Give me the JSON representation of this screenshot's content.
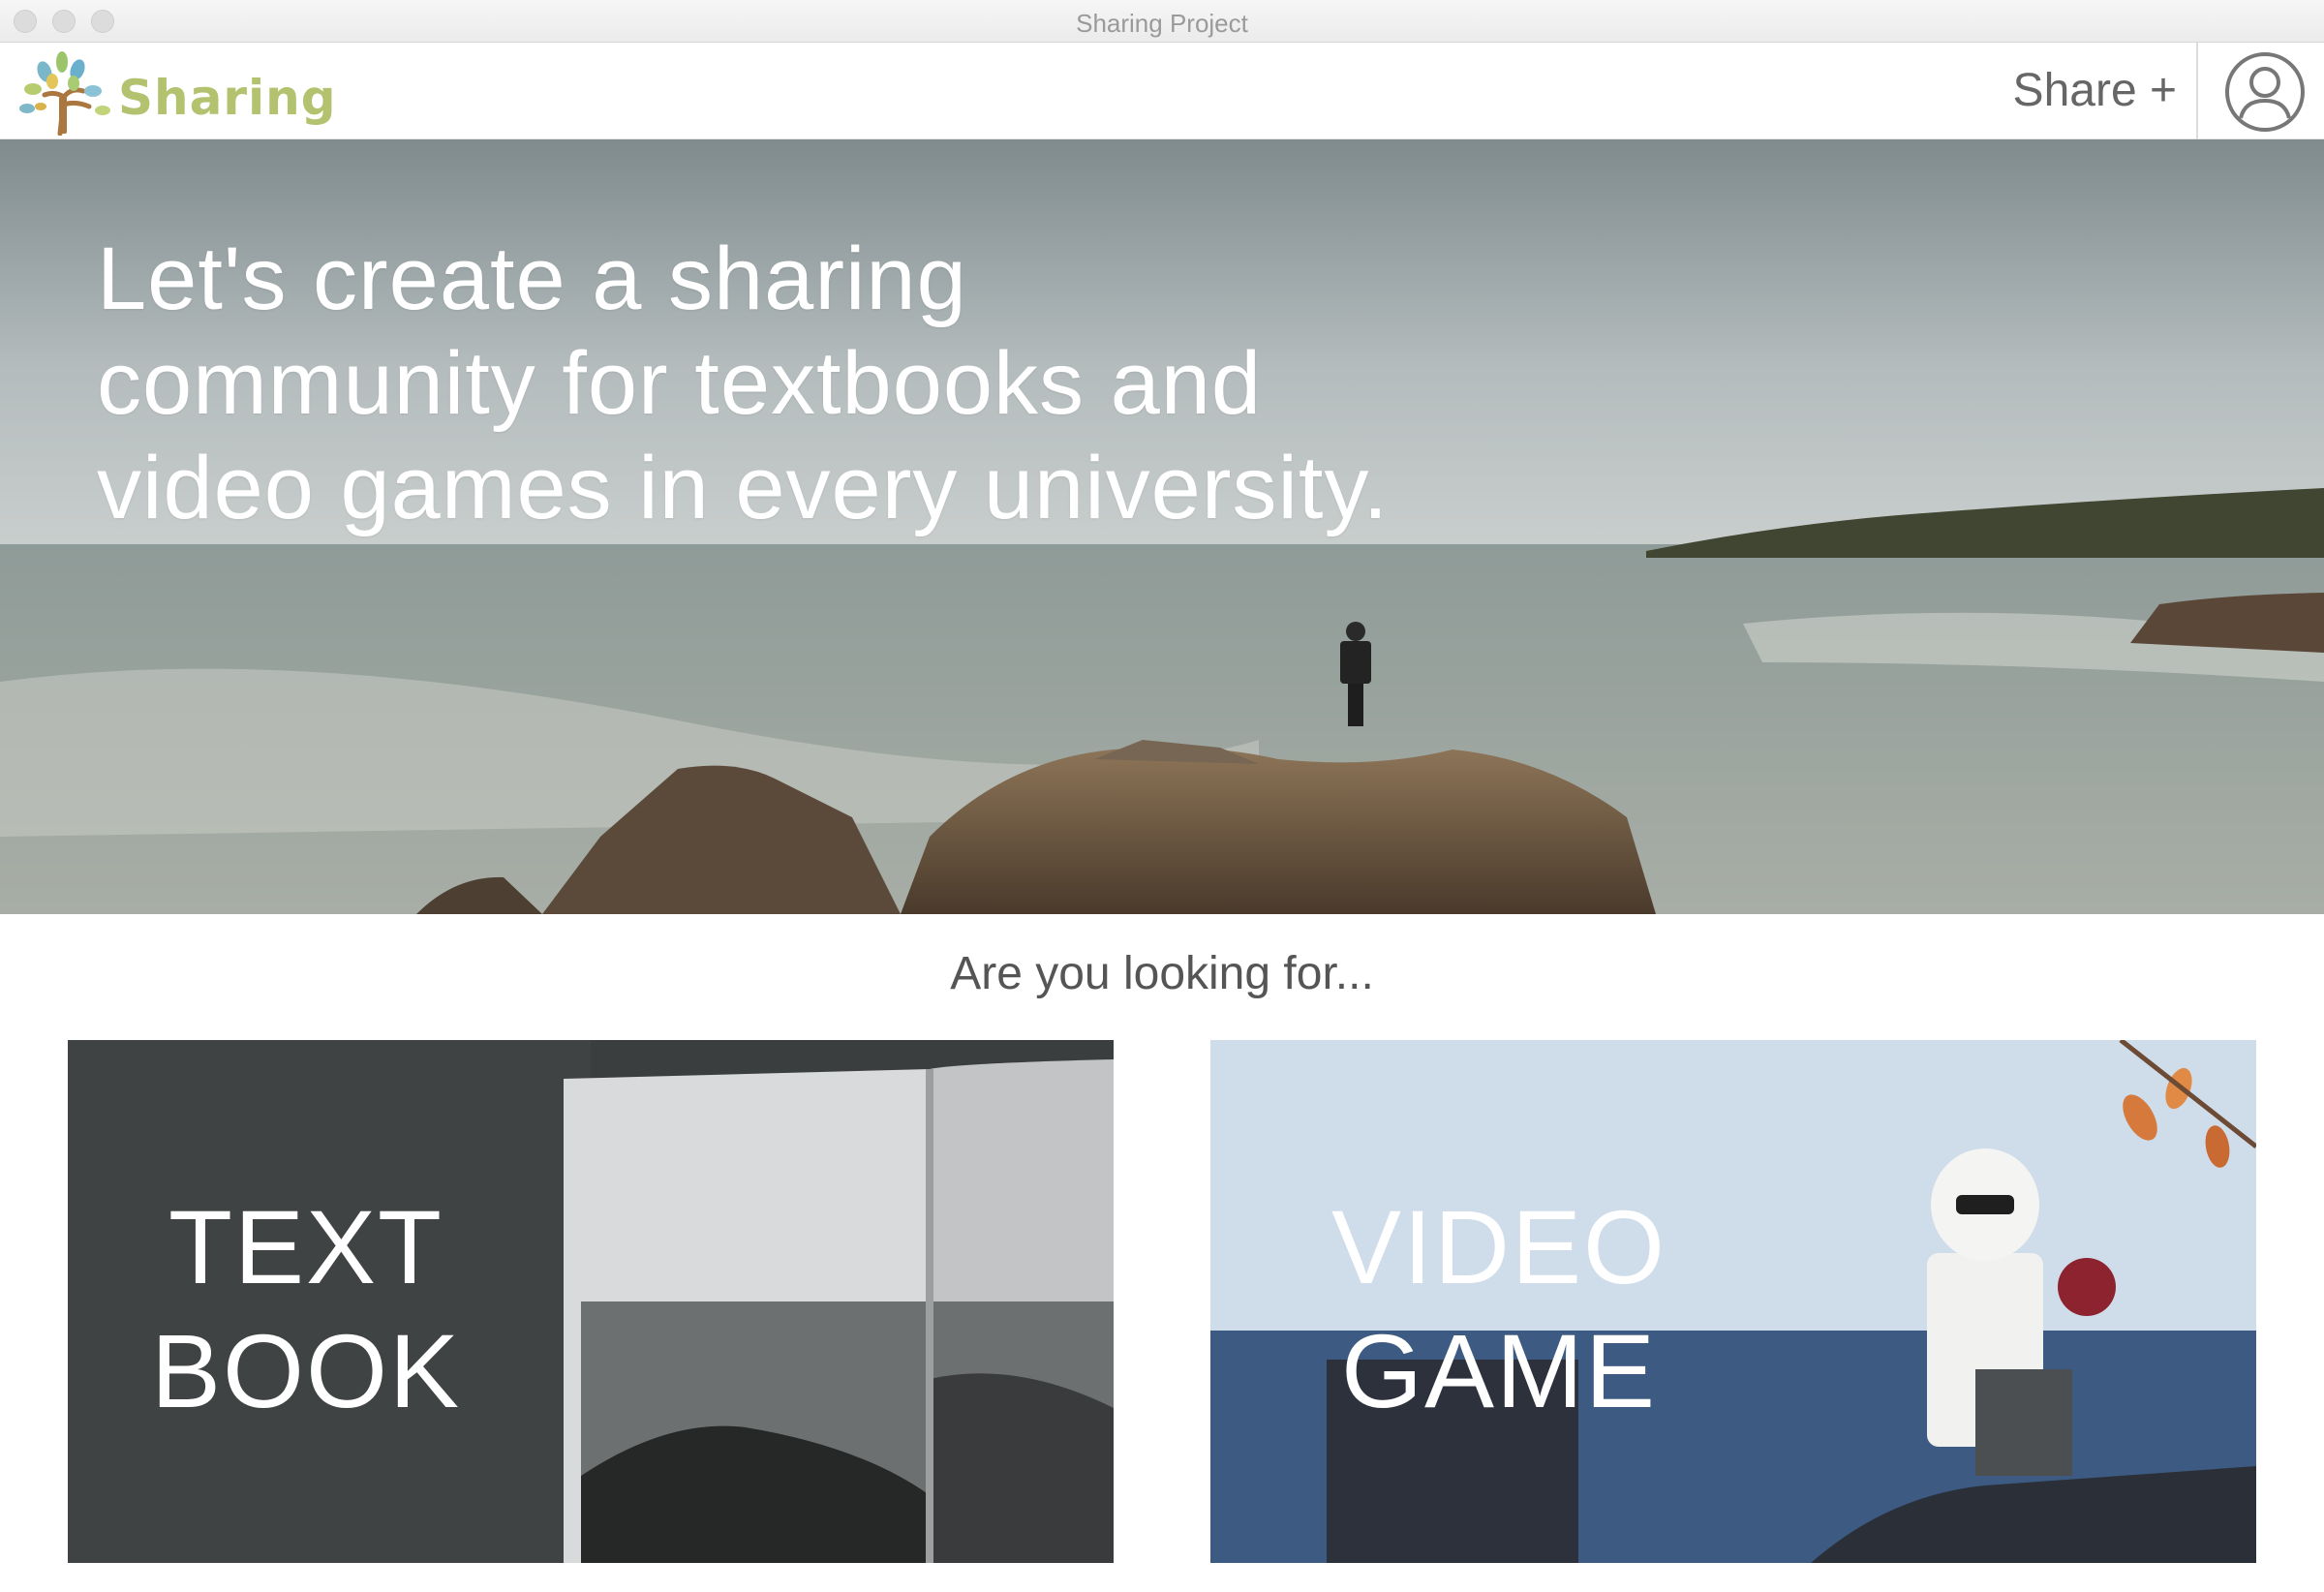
{
  "window": {
    "title": "Sharing Project"
  },
  "header": {
    "brand": "Sharing",
    "share_label": "Share +"
  },
  "hero": {
    "heading_lines": [
      "Let's create a sharing",
      "community for textbooks and",
      "video games in every university."
    ]
  },
  "looking_for": {
    "prompt": "Are you looking for...",
    "cards": [
      {
        "label_line1": "TEXT",
        "label_line2": "BOOK"
      },
      {
        "label_line1": "VIDEO",
        "label_line2": "GAME"
      }
    ]
  },
  "colors": {
    "brand_text": "#b3c26e",
    "header_text": "#666666",
    "prompt_text": "#555555"
  },
  "icons": {
    "avatar": "user-circle-icon",
    "logo": "tree-logo-icon"
  }
}
